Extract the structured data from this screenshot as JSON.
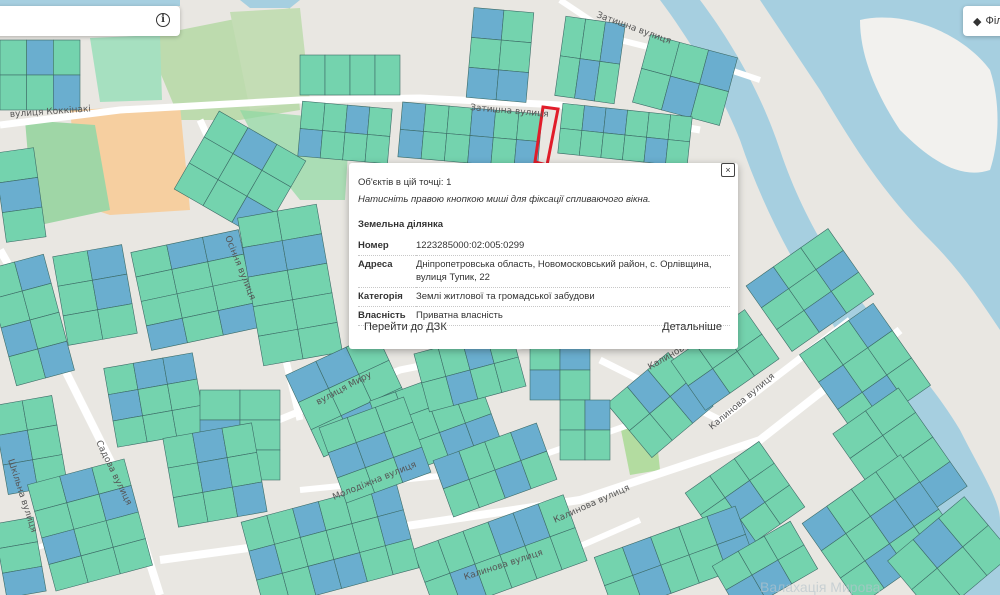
{
  "map": {
    "streets": [
      {
        "id": "zatyshna-1",
        "name": "Затишна вулиця"
      },
      {
        "id": "zatyshna-2",
        "name": "Затишна вулиця"
      },
      {
        "id": "kokkinaki",
        "name": "вулиця Коккінакі"
      },
      {
        "id": "osinnia",
        "name": "Осіння вулиця"
      },
      {
        "id": "myru",
        "name": "вулиця Миру"
      },
      {
        "id": "molodizhna",
        "name": "Молодіжна вулиця"
      },
      {
        "id": "sadova",
        "name": "Садова вулиця"
      },
      {
        "id": "shkilna",
        "name": "Шкільна вулиця"
      },
      {
        "id": "kalynova-1",
        "name": "Калинова вулиця"
      },
      {
        "id": "kalynova-2",
        "name": "Калинова вулиця"
      },
      {
        "id": "kalynova-3",
        "name": "Калинова вулиця"
      },
      {
        "id": "kalynova-4",
        "name": "Калинова вулиця"
      }
    ],
    "watermark": "Валахація Мирова"
  },
  "search": {
    "value": "",
    "info_icon": "info-icon"
  },
  "layers": {
    "label": "Філ",
    "icon": "layers-icon"
  },
  "popup": {
    "objects_count": "Об'єктів в цій точці: 1",
    "hint": "Натисніть правою кнопкою миші для фіксації спливаючого вікна.",
    "heading": "Земельна ділянка",
    "rows": [
      {
        "key": "Номер",
        "value": "1223285000:02:005:0299"
      },
      {
        "key": "Адреса",
        "value": "Дніпропетровська область, Новомосковський район, с. Орлівщина, вулиця Тупик, 22"
      },
      {
        "key": "Категорія",
        "value": "Землі житлової та громадської забудови"
      },
      {
        "key": "Власність",
        "value": "Приватна власність"
      }
    ],
    "go_dzk": "Перейти до ДЗК",
    "details": "Детальніше",
    "close": "×"
  },
  "colors": {
    "parcel_green": "#74d3ae",
    "parcel_blue": "#6aaecf",
    "water": "#a6cfe0",
    "highlight": "#e11d2a"
  }
}
